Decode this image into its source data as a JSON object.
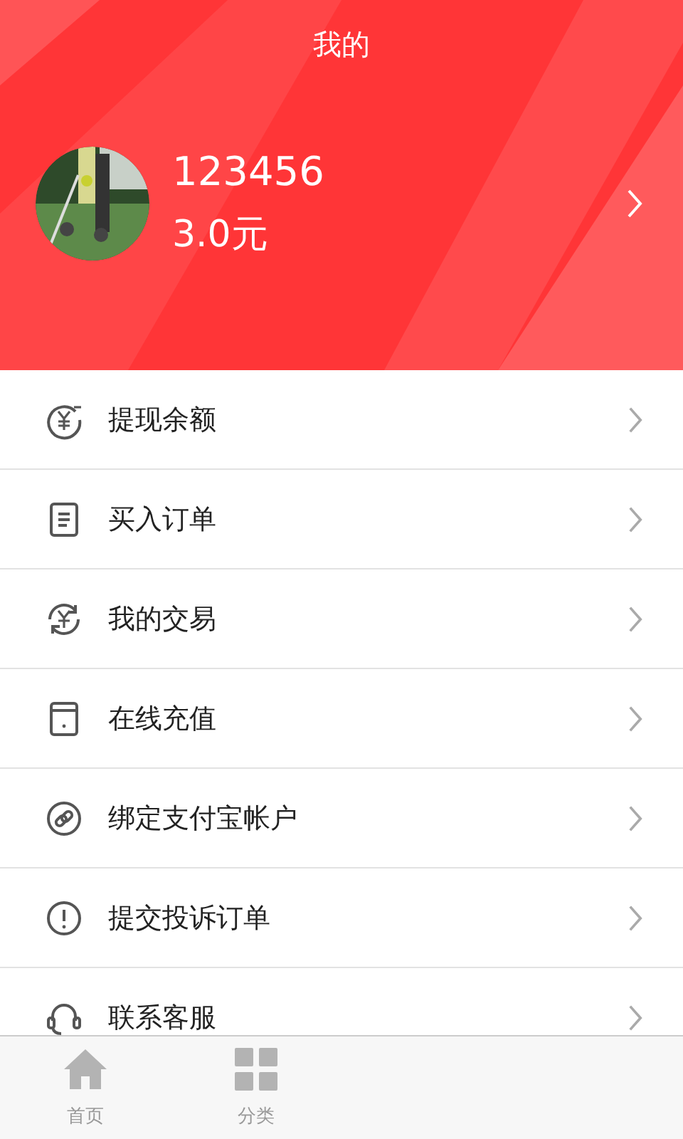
{
  "header": {
    "title": "我的",
    "profile": {
      "username": "123456",
      "balance": "3.0元"
    }
  },
  "menu": [
    {
      "label": "提现余额",
      "kind": "withdraw"
    },
    {
      "label": "买入订单",
      "kind": "document"
    },
    {
      "label": "我的交易",
      "kind": "exchange"
    },
    {
      "label": "在线充值",
      "kind": "card"
    },
    {
      "label": "绑定支付宝帐户",
      "kind": "link"
    },
    {
      "label": "提交投诉订单",
      "kind": "alert"
    },
    {
      "label": "联系客服",
      "kind": "headset"
    }
  ],
  "tab_bar": [
    {
      "label": "首页",
      "kind": "home",
      "selected": false
    },
    {
      "label": "分类",
      "kind": "grid",
      "selected": false
    }
  ]
}
